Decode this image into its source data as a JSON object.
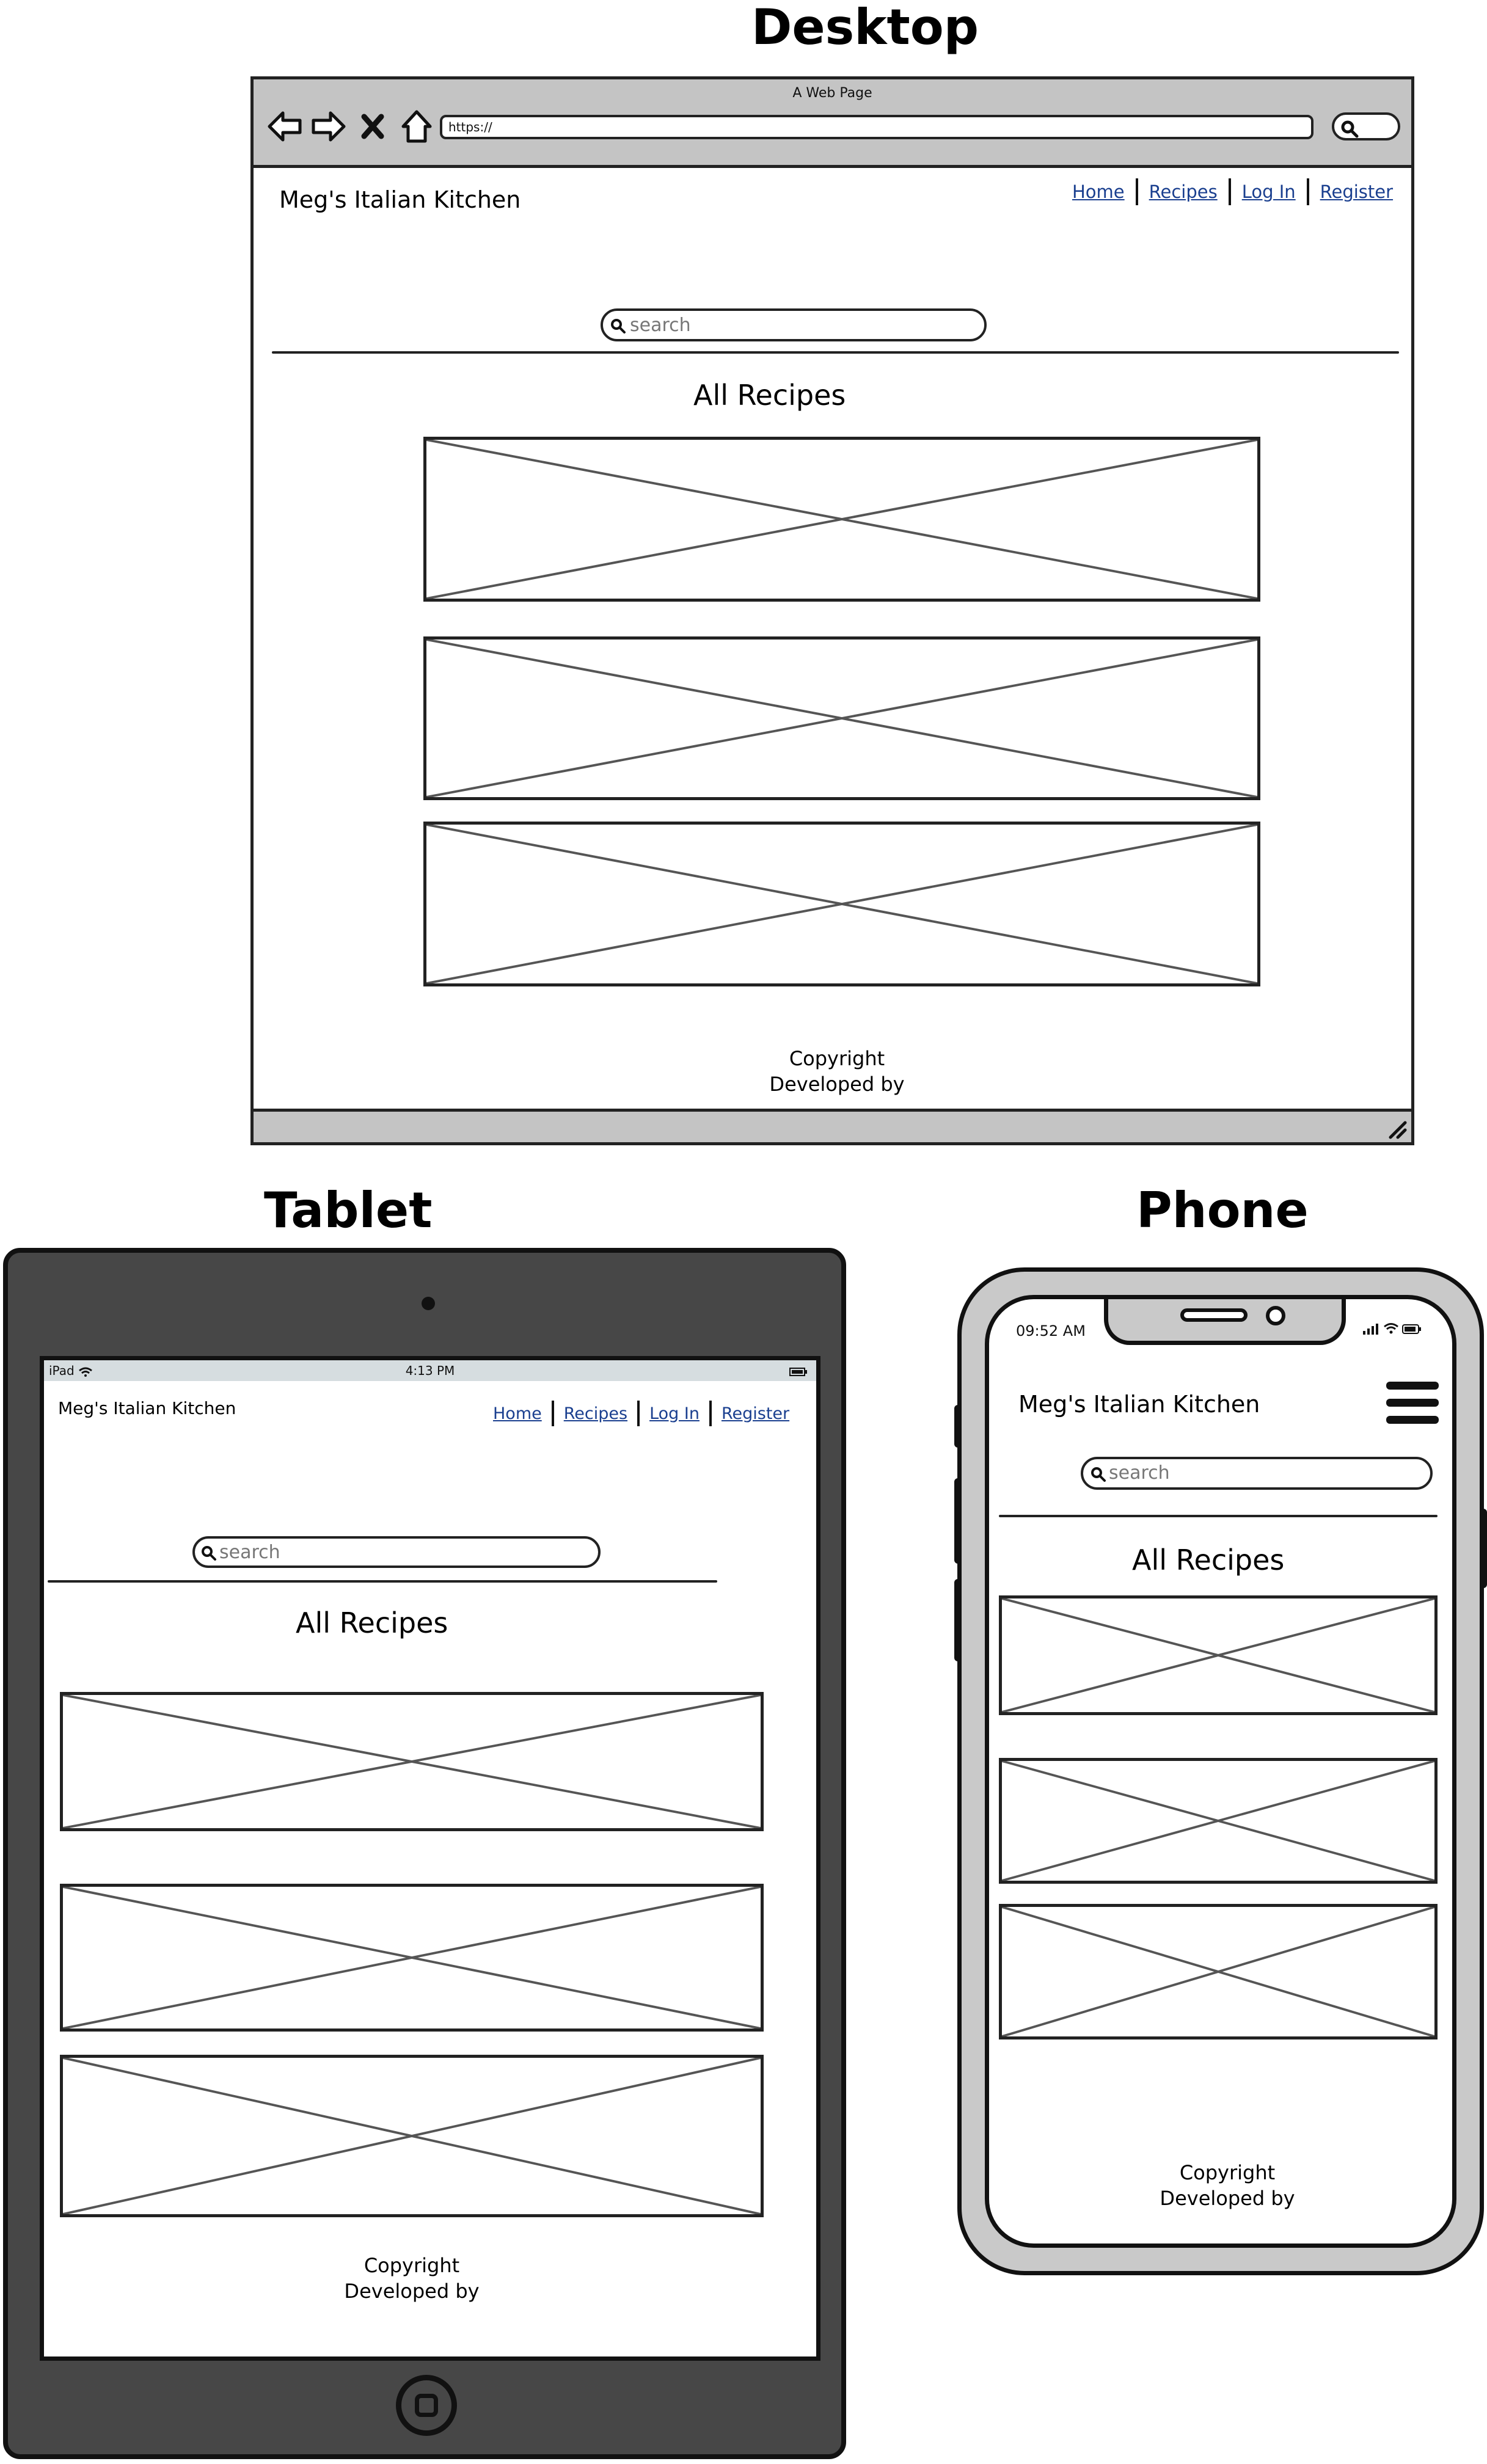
{
  "sections": {
    "desktop": "Desktop",
    "tablet": "Tablet",
    "phone": "Phone"
  },
  "browser": {
    "window_title": "A Web Page",
    "url": "https://"
  },
  "site": {
    "title": "Meg's Italian Kitchen",
    "nav": [
      "Home",
      "Recipes",
      "Log In",
      "Register"
    ],
    "search_placeholder": "search",
    "heading": "All Recipes",
    "footer_line1": "Copyright",
    "footer_line2": "Developed by"
  },
  "tablet": {
    "carrier": "iPad",
    "time": "4:13 PM"
  },
  "phone": {
    "time": "09:52 AM"
  },
  "colors": {
    "frame": "#474747",
    "chrome": "#c4c4c4",
    "link": "#1a3f8f"
  },
  "icons": [
    "back-arrow-icon",
    "forward-arrow-icon",
    "close-icon",
    "home-icon",
    "search-icon",
    "wifi-icon",
    "battery-icon",
    "signal-icon",
    "hamburger-menu-icon"
  ]
}
